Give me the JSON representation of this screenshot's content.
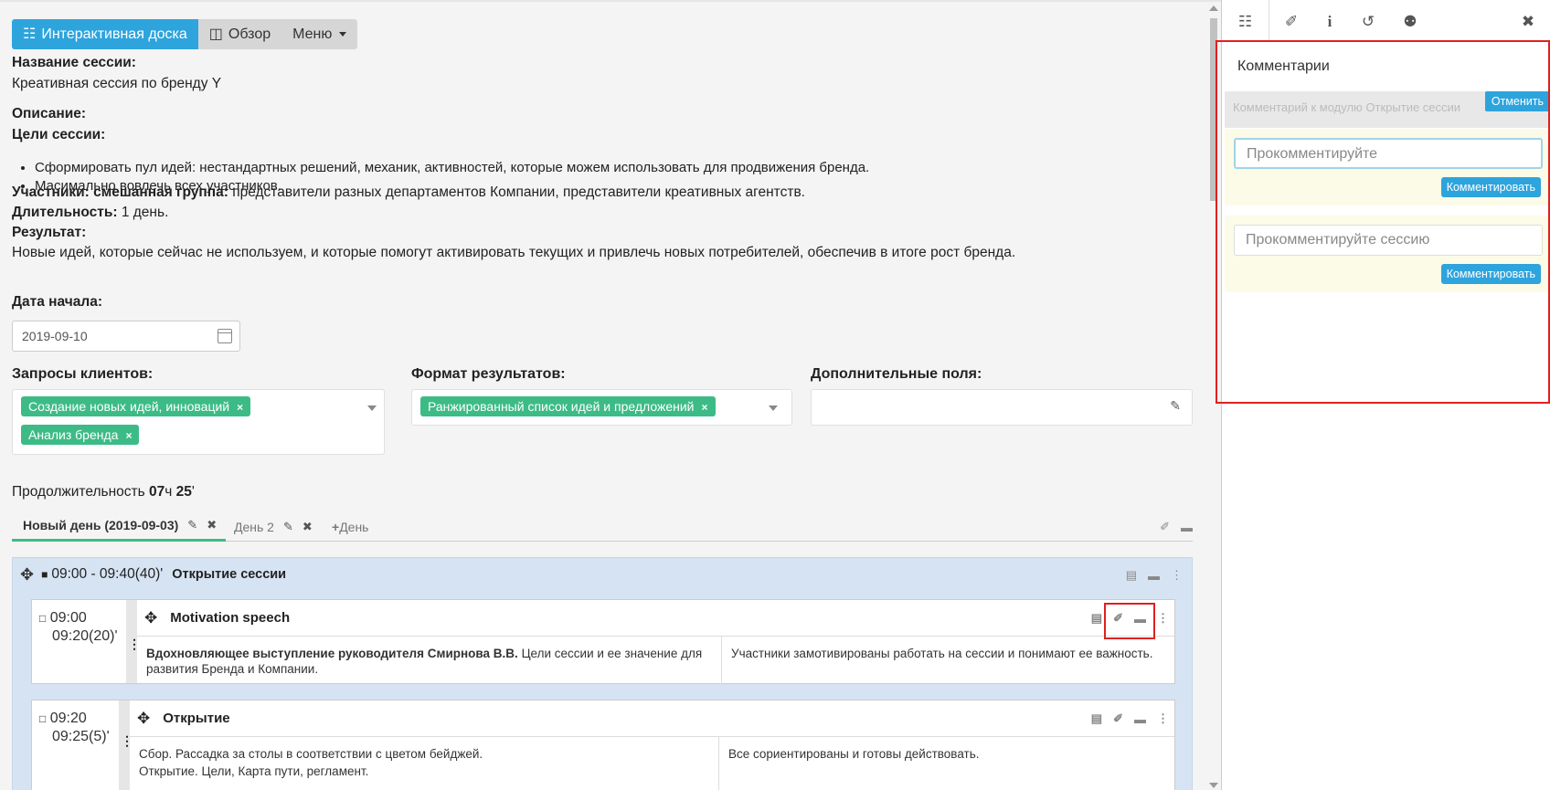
{
  "toolbar": {
    "whiteboard_label": "Интерактивная доска",
    "overview_label": "Обзор",
    "menu_label": "Меню"
  },
  "session": {
    "name_label": "Название сессии:",
    "name_value": "Креативная сессия по бренду Y",
    "description_label": "Описание:",
    "goals_label": "Цели сессии:",
    "goals": [
      "Сформировать пул идей: нестандартных решений, механик, активностей, которые можем использовать для продвижения бренда.",
      "Масимально вовлечь всех участников."
    ],
    "participants_label": "Участники: смешанная группа:",
    "participants_value": " представители разных департаментов Компании, представители креативных агентств.",
    "duration_label": "Длительность:",
    "duration_value": " 1 день.",
    "result_label": "Результат:",
    "result_value": "Новые идей, которые сейчас не используем, и которые помогут активировать текущих и привлечь новых потребителей, обеспечив в итоге рост бренда.",
    "start_date_label": "Дата начала:",
    "start_date_value": "2019-09-10"
  },
  "fields": {
    "client_requests_label": "Запросы клиентов:",
    "client_requests_tags": [
      "Создание новых идей, инноваций",
      "Анализ бренда"
    ],
    "format_label": "Формат результатов:",
    "format_tags": [
      "Ранжированный список идей и предложений"
    ],
    "extra_label": "Дополнительные поля:",
    "tag_remove": "×"
  },
  "duration": {
    "prefix": "Продолжительность ",
    "hours": "07",
    "h_unit": "ч ",
    "minutes": "25",
    "m_unit": "'"
  },
  "tabs": {
    "day1": "Новый день (2019-09-03)",
    "day2": "День 2",
    "add_day": "День"
  },
  "block": {
    "time": "09:00 - 09:40(40)'",
    "title": "Открытие сессии",
    "cards": [
      {
        "time_start": "09:00",
        "time_end": "09:20(20)'",
        "title": "Motivation speech",
        "left_bold": "Вдохновляющее выступление руководителя Смирнова В.В.",
        "left_text": " Цели сессии и ее значение для развития Бренда и Компании.",
        "right_text": "Участники замотивированы работать на сессии и понимают ее важность."
      },
      {
        "time_start": "09:20",
        "time_end": "09:25(5)'",
        "title": "Открытие",
        "left_line1": "Сбор. Рассадка за столы в соответствии с цветом бейджей.",
        "left_line2": "Открытие. Цели, Карта пути, регламент.",
        "right_text": "Все сориентированы и готовы действовать."
      }
    ]
  },
  "side": {
    "comments_title": "Комментарии",
    "module_comment_placeholder": "Комментарий к модулю Открытие сессии",
    "cancel_label": "Отменить",
    "comment_placeholder": "Прокомментируйте",
    "comment_button": "Комментировать",
    "session_comment_placeholder": "Прокомментируйте сессию",
    "session_comment_button": "Комментировать"
  },
  "colors": {
    "primary": "#2ea4dd",
    "tag_green": "#3dbb86",
    "block_blue": "#d6e3f3",
    "highlight_red": "#e02020"
  }
}
